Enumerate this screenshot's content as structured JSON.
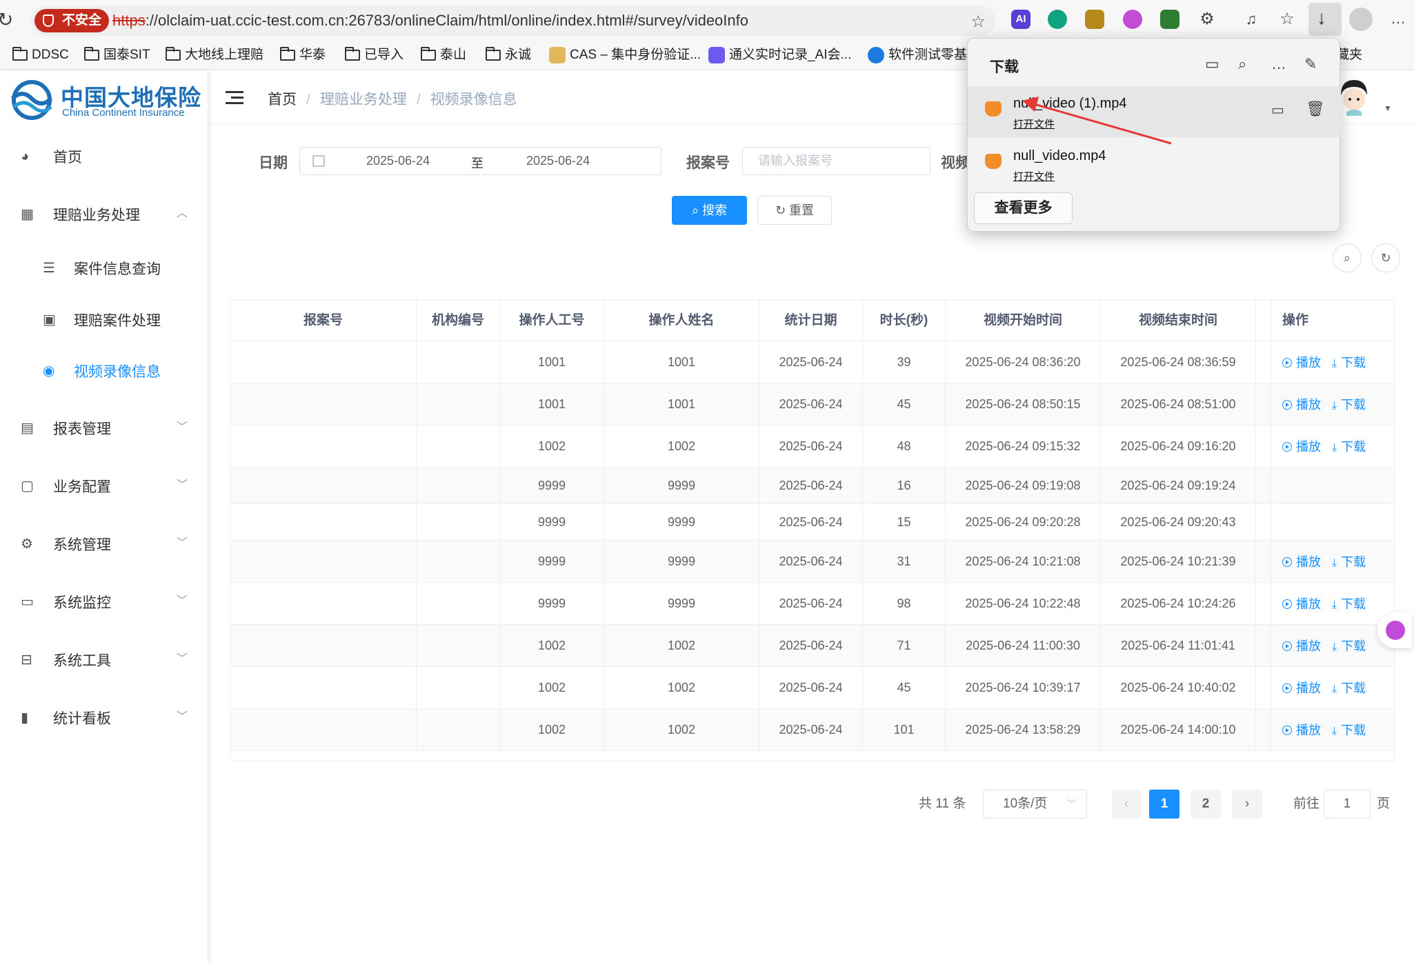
{
  "browser": {
    "unsafe_label": "不安全",
    "url_scheme": "https",
    "url_rest": "://olclaim-uat.ccic-test.com.cn:26783/onlineClaim/html/online/index.html#/survey/videoInfo",
    "ext_ai_label": "AI",
    "bookmarks": [
      "DDSC",
      "国泰SIT",
      "大地线上理赔",
      "华泰",
      "已导入",
      "泰山",
      "永诚",
      "CAS – 集中身份验证...",
      "通义实时记录_AI会...",
      "软件测试零基础",
      "其他收藏夹"
    ]
  },
  "logo": {
    "cn": "中国大地保险",
    "en": "China Continent Insurance"
  },
  "sidebar": {
    "items": [
      {
        "label": "首页",
        "icon": "dashboard-icon"
      },
      {
        "label": "理赔业务处理",
        "icon": "table-icon"
      },
      {
        "label": "案件信息查询",
        "icon": "list-icon"
      },
      {
        "label": "理赔案件处理",
        "icon": "image-icon"
      },
      {
        "label": "视频录像信息",
        "icon": "eye-icon"
      },
      {
        "label": "报表管理",
        "icon": "calendar-icon"
      },
      {
        "label": "业务配置",
        "icon": "settings-doc-icon"
      },
      {
        "label": "系统管理",
        "icon": "gear-icon"
      },
      {
        "label": "系统监控",
        "icon": "monitor-icon"
      },
      {
        "label": "系统工具",
        "icon": "toolbox-icon"
      },
      {
        "label": "统计看板",
        "icon": "bar-chart-icon"
      }
    ]
  },
  "breadcrumb": [
    "首页",
    "理赔业务处理",
    "视频录像信息"
  ],
  "filter": {
    "date_label": "日期",
    "date_start": "2025-06-24",
    "date_sep": "至",
    "date_end": "2025-06-24",
    "report_label": "报案号",
    "report_placeholder": "请输入报案号",
    "video_label": "视频",
    "search_btn": "搜索",
    "reset_btn": "重置"
  },
  "table": {
    "headers": [
      "报案号",
      "机构编号",
      "操作人工号",
      "操作人姓名",
      "统计日期",
      "时长(秒)",
      "视频开始时间",
      "视频结束时间",
      "操作"
    ],
    "play_label": "播放",
    "download_label": "下载",
    "rows": [
      {
        "report": "",
        "org": "",
        "op_id": "1001",
        "op_name": "1001",
        "date": "2025-06-24",
        "dur": "39",
        "start": "2025-06-24 08:36:20",
        "end": "2025-06-24 08:36:59",
        "actions": true
      },
      {
        "report": "",
        "org": "",
        "op_id": "1001",
        "op_name": "1001",
        "date": "2025-06-24",
        "dur": "45",
        "start": "2025-06-24 08:50:15",
        "end": "2025-06-24 08:51:00",
        "actions": true
      },
      {
        "report": "",
        "org": "",
        "op_id": "1002",
        "op_name": "1002",
        "date": "2025-06-24",
        "dur": "48",
        "start": "2025-06-24 09:15:32",
        "end": "2025-06-24 09:16:20",
        "actions": true
      },
      {
        "report": "",
        "org": "",
        "op_id": "9999",
        "op_name": "9999",
        "date": "2025-06-24",
        "dur": "16",
        "start": "2025-06-24 09:19:08",
        "end": "2025-06-24 09:19:24",
        "actions": false
      },
      {
        "report": "",
        "org": "",
        "op_id": "9999",
        "op_name": "9999",
        "date": "2025-06-24",
        "dur": "15",
        "start": "2025-06-24 09:20:28",
        "end": "2025-06-24 09:20:43",
        "actions": false
      },
      {
        "report": "",
        "org": "",
        "op_id": "9999",
        "op_name": "9999",
        "date": "2025-06-24",
        "dur": "31",
        "start": "2025-06-24 10:21:08",
        "end": "2025-06-24 10:21:39",
        "actions": true
      },
      {
        "report": "",
        "org": "",
        "op_id": "9999",
        "op_name": "9999",
        "date": "2025-06-24",
        "dur": "98",
        "start": "2025-06-24 10:22:48",
        "end": "2025-06-24 10:24:26",
        "actions": true
      },
      {
        "report": "",
        "org": "",
        "op_id": "1002",
        "op_name": "1002",
        "date": "2025-06-24",
        "dur": "71",
        "start": "2025-06-24 11:00:30",
        "end": "2025-06-24 11:01:41",
        "actions": true
      },
      {
        "report": "",
        "org": "",
        "op_id": "1002",
        "op_name": "1002",
        "date": "2025-06-24",
        "dur": "45",
        "start": "2025-06-24 10:39:17",
        "end": "2025-06-24 10:40:02",
        "actions": true
      },
      {
        "report": "",
        "org": "",
        "op_id": "1002",
        "op_name": "1002",
        "date": "2025-06-24",
        "dur": "101",
        "start": "2025-06-24 13:58:29",
        "end": "2025-06-24 14:00:10",
        "actions": true
      }
    ]
  },
  "pagination": {
    "total_prefix": "共",
    "total": "11",
    "total_suffix": "条",
    "page_size": "10条/页",
    "pages": [
      "1",
      "2"
    ],
    "current": "1",
    "goto_label": "前往",
    "goto_value": "1",
    "goto_suffix": "页"
  },
  "downloads": {
    "title": "下载",
    "items": [
      {
        "name": "null_video (1).mp4",
        "action": "打开文件"
      },
      {
        "name": "null_video.mp4",
        "action": "打开文件"
      }
    ],
    "more_btn": "查看更多"
  },
  "colors": {
    "primary": "#1890ff",
    "unsafe": "#c42b1c",
    "brand": "#1e6fb5",
    "annotation_arrow": "#e53935"
  }
}
